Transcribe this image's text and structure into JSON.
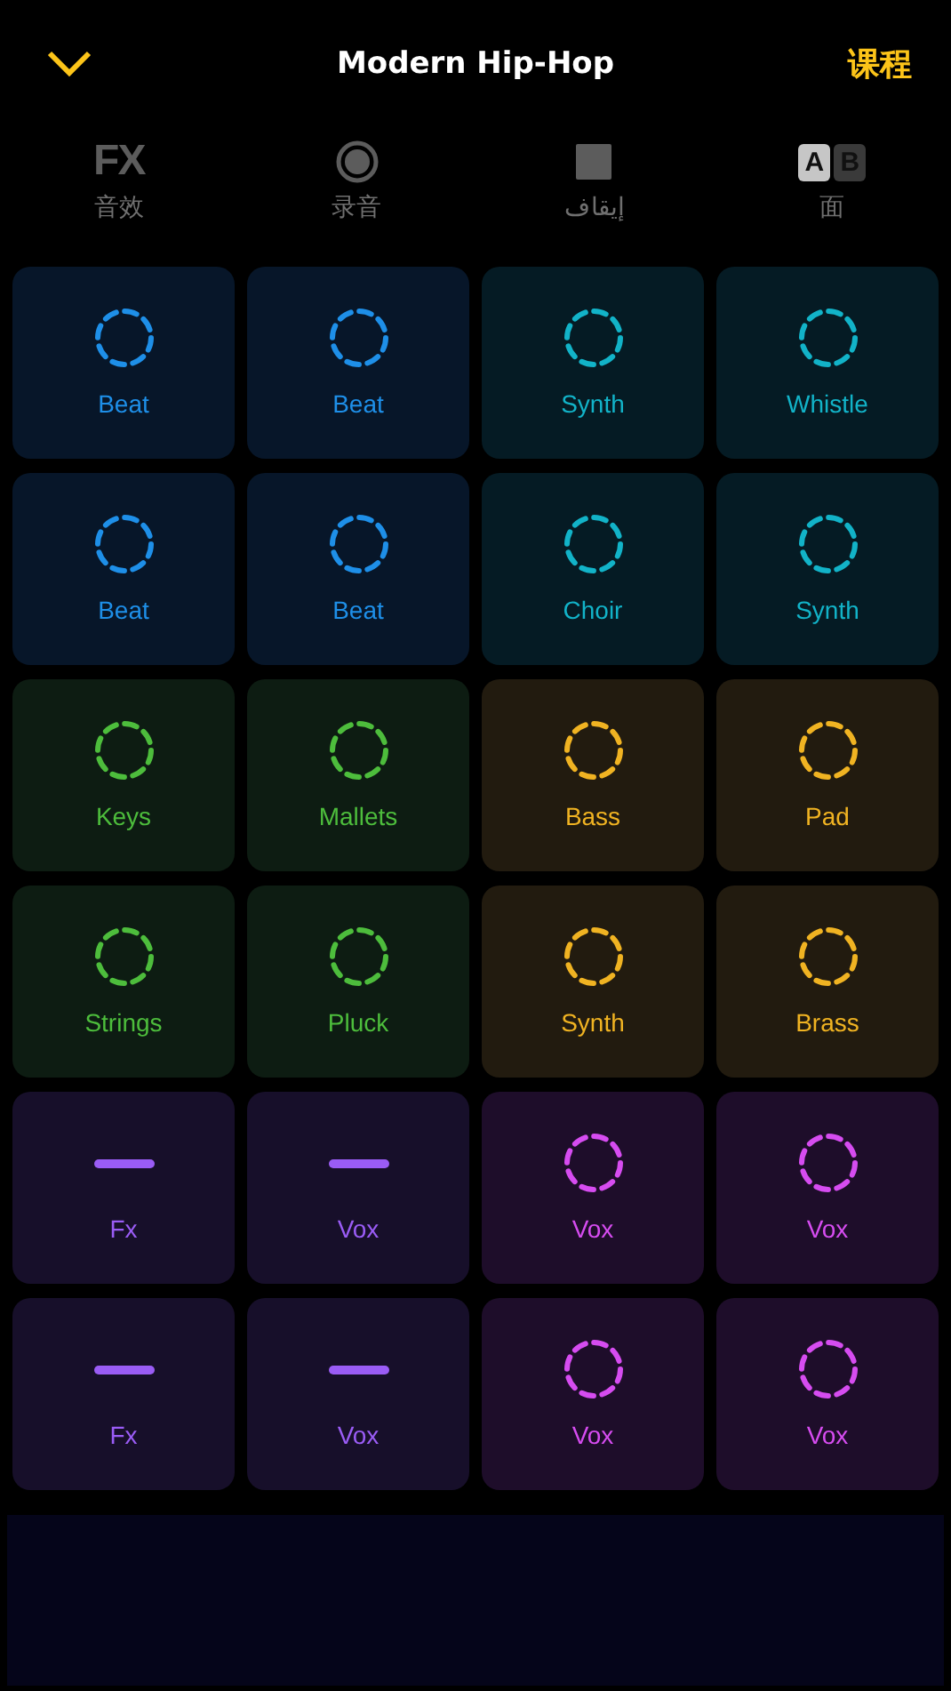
{
  "header": {
    "title": "Modern Hip-Hop",
    "action": "课程"
  },
  "toolbar": [
    {
      "kind": "fx",
      "glyph": "FX",
      "label": "音效"
    },
    {
      "kind": "record",
      "label": "录音"
    },
    {
      "kind": "stop",
      "label": "إيقاف"
    },
    {
      "kind": "ab",
      "glyph": "A",
      "glyph_2": "B",
      "label": "面"
    }
  ],
  "pads": [
    {
      "label": "Beat",
      "kind": "loop",
      "color": "#1e8fe8"
    },
    {
      "label": "Beat",
      "kind": "loop",
      "color": "#1e8fe8"
    },
    {
      "label": "Synth",
      "kind": "loop",
      "color": "#12b3c8"
    },
    {
      "label": "Whistle",
      "kind": "loop",
      "color": "#12b3c8"
    },
    {
      "label": "Beat",
      "kind": "loop",
      "color": "#1e8fe8"
    },
    {
      "label": "Beat",
      "kind": "loop",
      "color": "#1e8fe8"
    },
    {
      "label": "Choir",
      "kind": "loop",
      "color": "#12b3c8"
    },
    {
      "label": "Synth",
      "kind": "loop",
      "color": "#12b3c8"
    },
    {
      "label": "Keys",
      "kind": "loop",
      "color": "#4dbd3c"
    },
    {
      "label": "Mallets",
      "kind": "loop",
      "color": "#4dbd3c"
    },
    {
      "label": "Bass",
      "kind": "loop",
      "color": "#f0b322"
    },
    {
      "label": "Pad",
      "kind": "loop",
      "color": "#f0b322"
    },
    {
      "label": "Strings",
      "kind": "loop",
      "color": "#4dbd3c"
    },
    {
      "label": "Pluck",
      "kind": "loop",
      "color": "#4dbd3c"
    },
    {
      "label": "Synth",
      "kind": "loop",
      "color": "#f0b322"
    },
    {
      "label": "Brass",
      "kind": "loop",
      "color": "#f0b322"
    },
    {
      "label": "Fx",
      "kind": "oneshot",
      "color": "#9a5cf5"
    },
    {
      "label": "Vox",
      "kind": "oneshot",
      "color": "#9a5cf5"
    },
    {
      "label": "Vox",
      "kind": "loop",
      "color": "#d64cf0"
    },
    {
      "label": "Vox",
      "kind": "loop",
      "color": "#d64cf0"
    },
    {
      "label": "Fx",
      "kind": "oneshot",
      "color": "#9a5cf5"
    },
    {
      "label": "Vox",
      "kind": "oneshot",
      "color": "#9a5cf5"
    },
    {
      "label": "Vox",
      "kind": "loop",
      "color": "#d64cf0"
    },
    {
      "label": "Vox",
      "kind": "loop",
      "color": "#d64cf0"
    }
  ]
}
